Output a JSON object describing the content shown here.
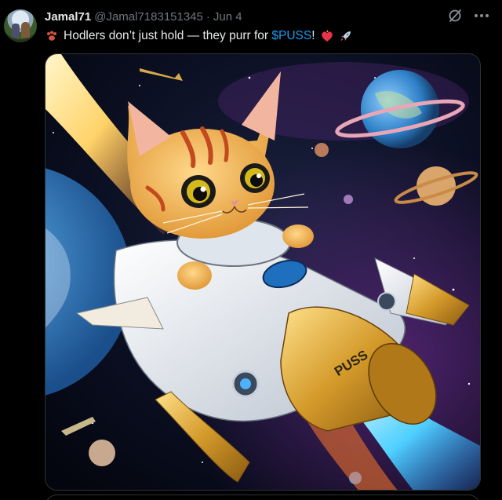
{
  "post": {
    "display_name": "Jamal71",
    "handle": "@Jamal7183151345",
    "separator": "·",
    "date": "Jun 4",
    "text_before": "Hodlers don’t just hold — they purr for ",
    "cashtag": "$PUSS",
    "text_after": "!",
    "emojis": [
      "paw-prints",
      "heart-on-fire",
      "rocket"
    ]
  },
  "media": {
    "rocket_label": "PUSS"
  },
  "colors": {
    "background": "#000000",
    "text": "#e7e9ea",
    "muted": "#71767b",
    "link": "#1d9bf0",
    "border": "#2f3336"
  }
}
